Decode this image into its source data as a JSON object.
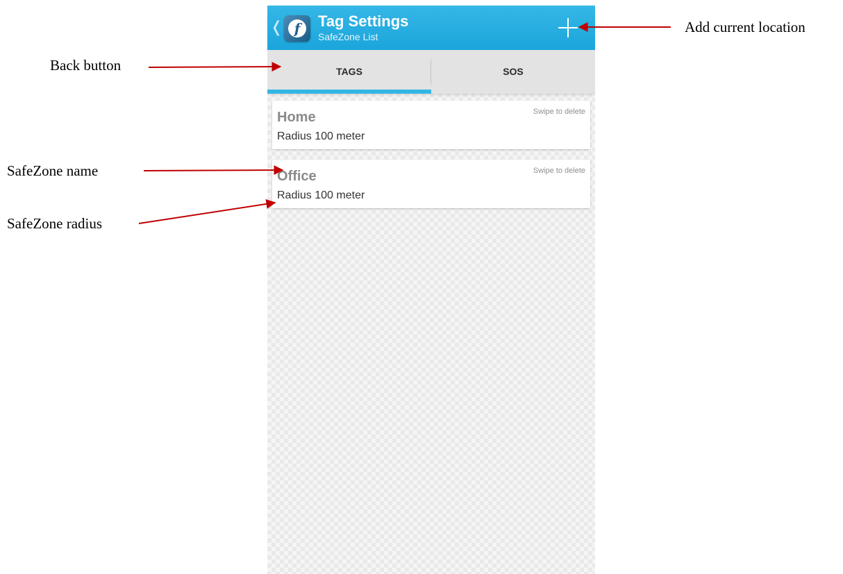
{
  "action_bar": {
    "title": "Tag Settings",
    "subtitle": "SafeZone List",
    "back_icon": "chevron-left-icon",
    "app_icon": "app-logo-icon",
    "add_icon": "plus-icon",
    "color": "#1ba5db"
  },
  "tabs": [
    {
      "label": "TAGS",
      "selected": true
    },
    {
      "label": "SOS",
      "selected": false
    }
  ],
  "safezones": [
    {
      "name": "Home",
      "radius_text": "Radius 100 meter",
      "hint": "Swipe to delete"
    },
    {
      "name": "Office",
      "radius_text": "Radius 100 meter",
      "hint": "Swipe to delete"
    }
  ],
  "annotations": {
    "add_current_location": "Add current location",
    "back_button": "Back button",
    "safezone_name": "SafeZone name",
    "safezone_radius": "SafeZone radius",
    "arrow_color": "#c00000"
  }
}
